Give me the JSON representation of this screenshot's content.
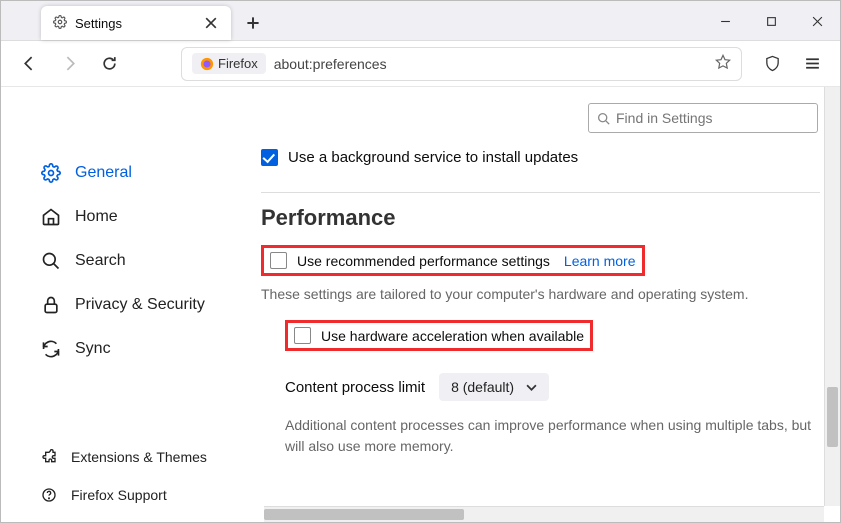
{
  "window": {
    "tab_title": "Settings",
    "url_identity": "Firefox",
    "url": "about:preferences"
  },
  "search": {
    "placeholder": "Find in Settings"
  },
  "sidebar": {
    "items": [
      {
        "label": "General"
      },
      {
        "label": "Home"
      },
      {
        "label": "Search"
      },
      {
        "label": "Privacy & Security"
      },
      {
        "label": "Sync"
      }
    ],
    "footer": [
      {
        "label": "Extensions & Themes"
      },
      {
        "label": "Firefox Support"
      }
    ]
  },
  "pane": {
    "updates_background_label": "Use a background service to install updates",
    "performance_title": "Performance",
    "use_recommended_label": "Use recommended performance settings",
    "learn_more": "Learn more",
    "tailored_desc": "These settings are tailored to your computer's hardware and operating system.",
    "use_hw_accel_label": "Use hardware acceleration when available",
    "content_process_label": "Content process limit",
    "content_process_value": "8 (default)",
    "content_process_note": "Additional content processes can improve performance when using multiple tabs, but will also use more memory."
  }
}
